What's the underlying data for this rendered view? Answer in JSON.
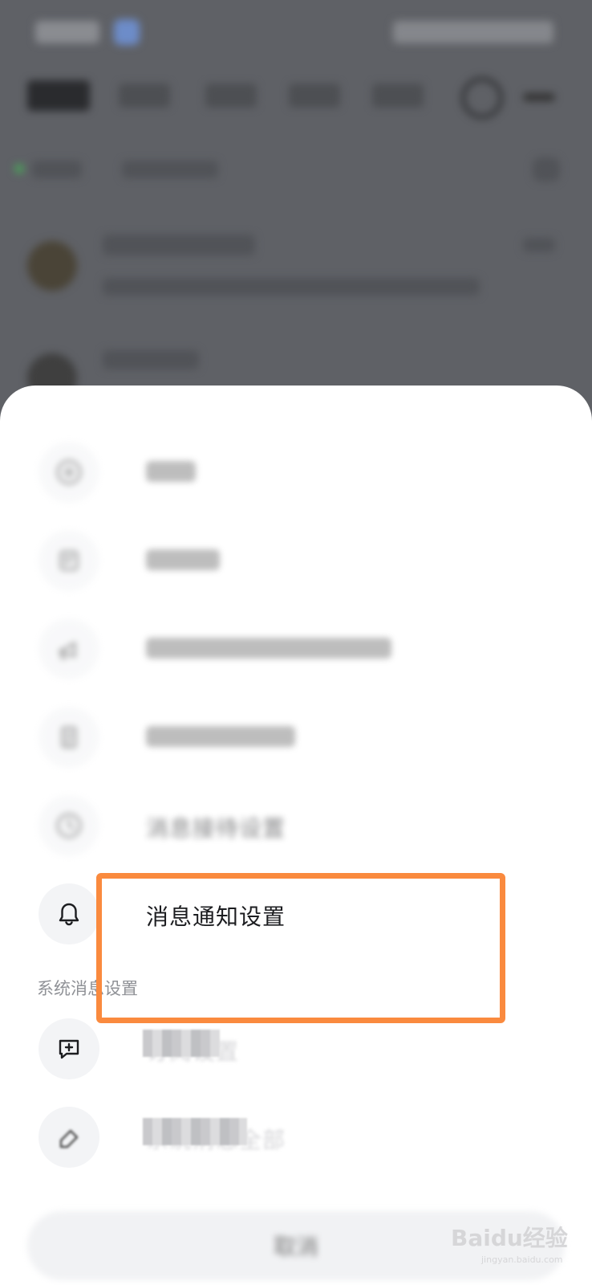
{
  "backdrop": {
    "tabs": [
      "",
      "",
      "",
      "",
      ""
    ]
  },
  "sheet": {
    "section_personal": "",
    "items_personal": [
      {
        "label": "",
        "icon": "circle-plus-icon"
      },
      {
        "label": "",
        "icon": "user-block-icon"
      },
      {
        "label": "",
        "icon": "megaphone-icon"
      },
      {
        "label": "",
        "icon": "document-icon"
      },
      {
        "label": "消息接待设置",
        "icon": "clock-icon"
      },
      {
        "label": "消息通知设置",
        "icon": "bell-icon"
      }
    ],
    "section_system": "系统消息设置",
    "items_system": [
      {
        "label": "订阅设置",
        "icon": "message-plus-icon"
      },
      {
        "label": "系统消息全部",
        "icon": "eraser-icon"
      }
    ],
    "cancel_label": "取消"
  },
  "colors": {
    "highlight": "#fa8a3e",
    "sheet_bg": "#ffffff",
    "overlay": "#5f6166"
  },
  "watermark": {
    "brand": "Baidu经验",
    "url": "jingyan.baidu.com"
  }
}
